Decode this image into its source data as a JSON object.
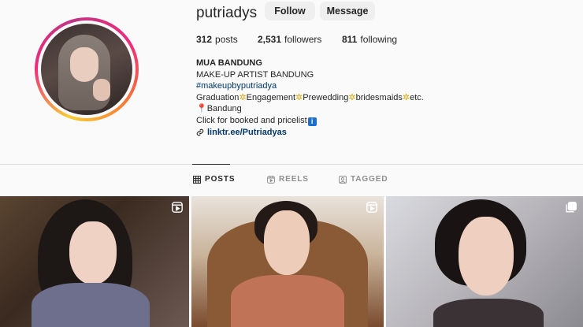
{
  "profile": {
    "username": "putriadys",
    "follow_label": "Follow",
    "message_label": "Message",
    "stats": {
      "posts_count": "312",
      "posts_label": "posts",
      "followers_count": "2,531",
      "followers_label": "followers",
      "following_count": "811",
      "following_label": "following"
    },
    "bio": {
      "name": "MUA BANDUNG",
      "line1": "MAKE-UP ARTIST BANDUNG",
      "hashtag": "#makeupbyputriadya",
      "services": [
        "Graduation",
        "Engagement",
        "Prewedding",
        "bridesmaids",
        "etc."
      ],
      "location": "Bandung",
      "cta": "Click for booked and pricelist",
      "link": "linktr.ee/Putriadyas"
    }
  },
  "tabs": [
    {
      "label": "POSTS",
      "icon": "grid-icon",
      "active": true
    },
    {
      "label": "REELS",
      "icon": "reels-icon",
      "active": false
    },
    {
      "label": "TAGGED",
      "icon": "tagged-icon",
      "active": false
    }
  ],
  "posts": [
    {
      "type": "reel",
      "badge_icon": "reels-icon"
    },
    {
      "type": "reel",
      "badge_icon": "reels-icon"
    },
    {
      "type": "carousel",
      "badge_icon": "carousel-icon"
    }
  ],
  "colors": {
    "link": "#00376b",
    "button_bg": "#efefef",
    "text": "#262626",
    "muted": "#8e8e8e"
  }
}
